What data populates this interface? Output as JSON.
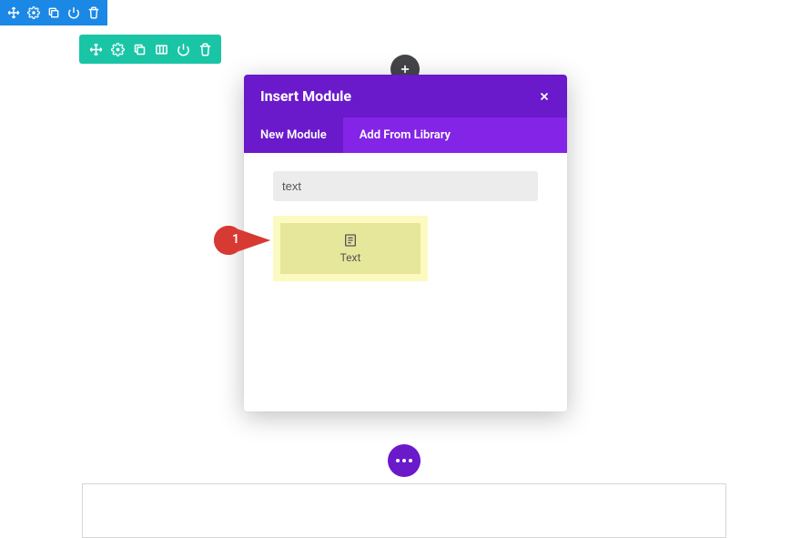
{
  "modal": {
    "title": "Insert Module",
    "tabs": {
      "new": "New Module",
      "library": "Add From Library"
    },
    "search_value": "text",
    "module_text": "Text"
  },
  "callout": {
    "number": "1"
  }
}
